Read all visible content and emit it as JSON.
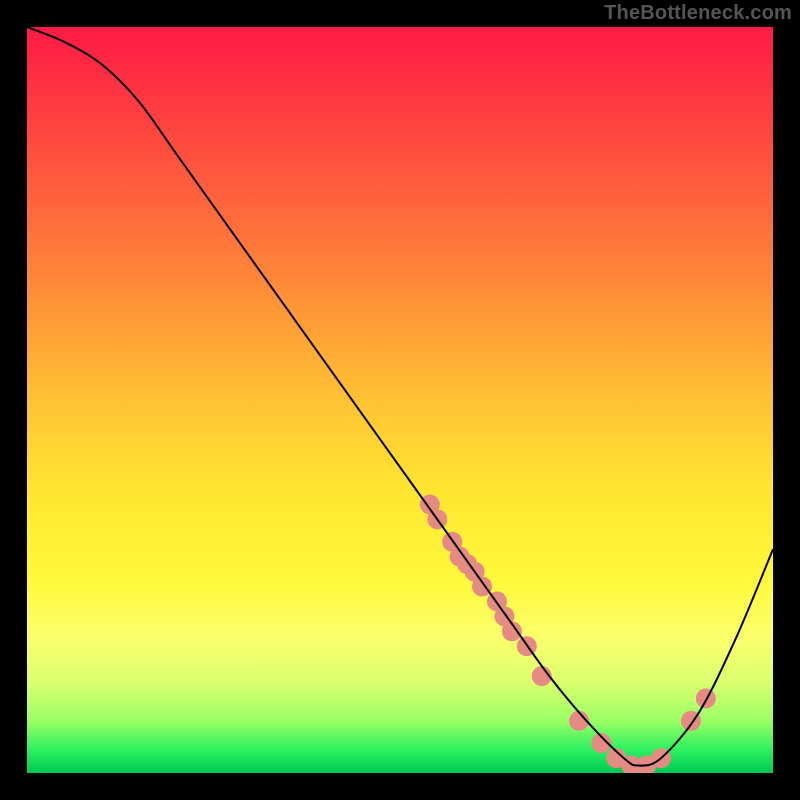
{
  "watermark": "TheBottleneck.com",
  "chart_data": {
    "type": "line",
    "title": "",
    "xlabel": "",
    "ylabel": "",
    "xlim": [
      0,
      100
    ],
    "ylim": [
      0,
      100
    ],
    "grid": false,
    "legend": false,
    "series": [
      {
        "name": "curve",
        "color": "#000000",
        "x": [
          0,
          5,
          10,
          15,
          20,
          25,
          30,
          35,
          40,
          45,
          50,
          55,
          60,
          65,
          70,
          75,
          80,
          82,
          85,
          90,
          95,
          100
        ],
        "y": [
          100,
          98,
          95,
          90,
          83,
          76,
          69,
          62,
          55,
          48,
          41,
          34,
          27,
          20,
          13,
          7,
          2,
          1,
          2,
          8,
          18,
          30
        ]
      }
    ],
    "markers": [
      {
        "name": "dots",
        "color": "#e58b84",
        "radius": 10,
        "points": [
          {
            "x": 54,
            "y": 36
          },
          {
            "x": 55,
            "y": 34
          },
          {
            "x": 57,
            "y": 31
          },
          {
            "x": 58,
            "y": 29
          },
          {
            "x": 59,
            "y": 28
          },
          {
            "x": 60,
            "y": 27
          },
          {
            "x": 61,
            "y": 25
          },
          {
            "x": 63,
            "y": 23
          },
          {
            "x": 64,
            "y": 21
          },
          {
            "x": 65,
            "y": 19
          },
          {
            "x": 67,
            "y": 17
          },
          {
            "x": 69,
            "y": 13
          },
          {
            "x": 74,
            "y": 7
          },
          {
            "x": 77,
            "y": 4
          },
          {
            "x": 79,
            "y": 2
          },
          {
            "x": 81,
            "y": 1
          },
          {
            "x": 83,
            "y": 1
          },
          {
            "x": 85,
            "y": 2
          },
          {
            "x": 89,
            "y": 7
          },
          {
            "x": 91,
            "y": 10
          }
        ]
      }
    ],
    "gradient_stops": [
      {
        "pos": 0,
        "color": "#ff1a45"
      },
      {
        "pos": 12,
        "color": "#ff3f40"
      },
      {
        "pos": 30,
        "color": "#ff7a3a"
      },
      {
        "pos": 50,
        "color": "#ffc233"
      },
      {
        "pos": 62,
        "color": "#ffe531"
      },
      {
        "pos": 74,
        "color": "#fff93a"
      },
      {
        "pos": 82,
        "color": "#fbff6c"
      },
      {
        "pos": 88,
        "color": "#d9ff6e"
      },
      {
        "pos": 93,
        "color": "#9aff65"
      },
      {
        "pos": 97,
        "color": "#29f060"
      },
      {
        "pos": 100,
        "color": "#00c853"
      }
    ]
  }
}
